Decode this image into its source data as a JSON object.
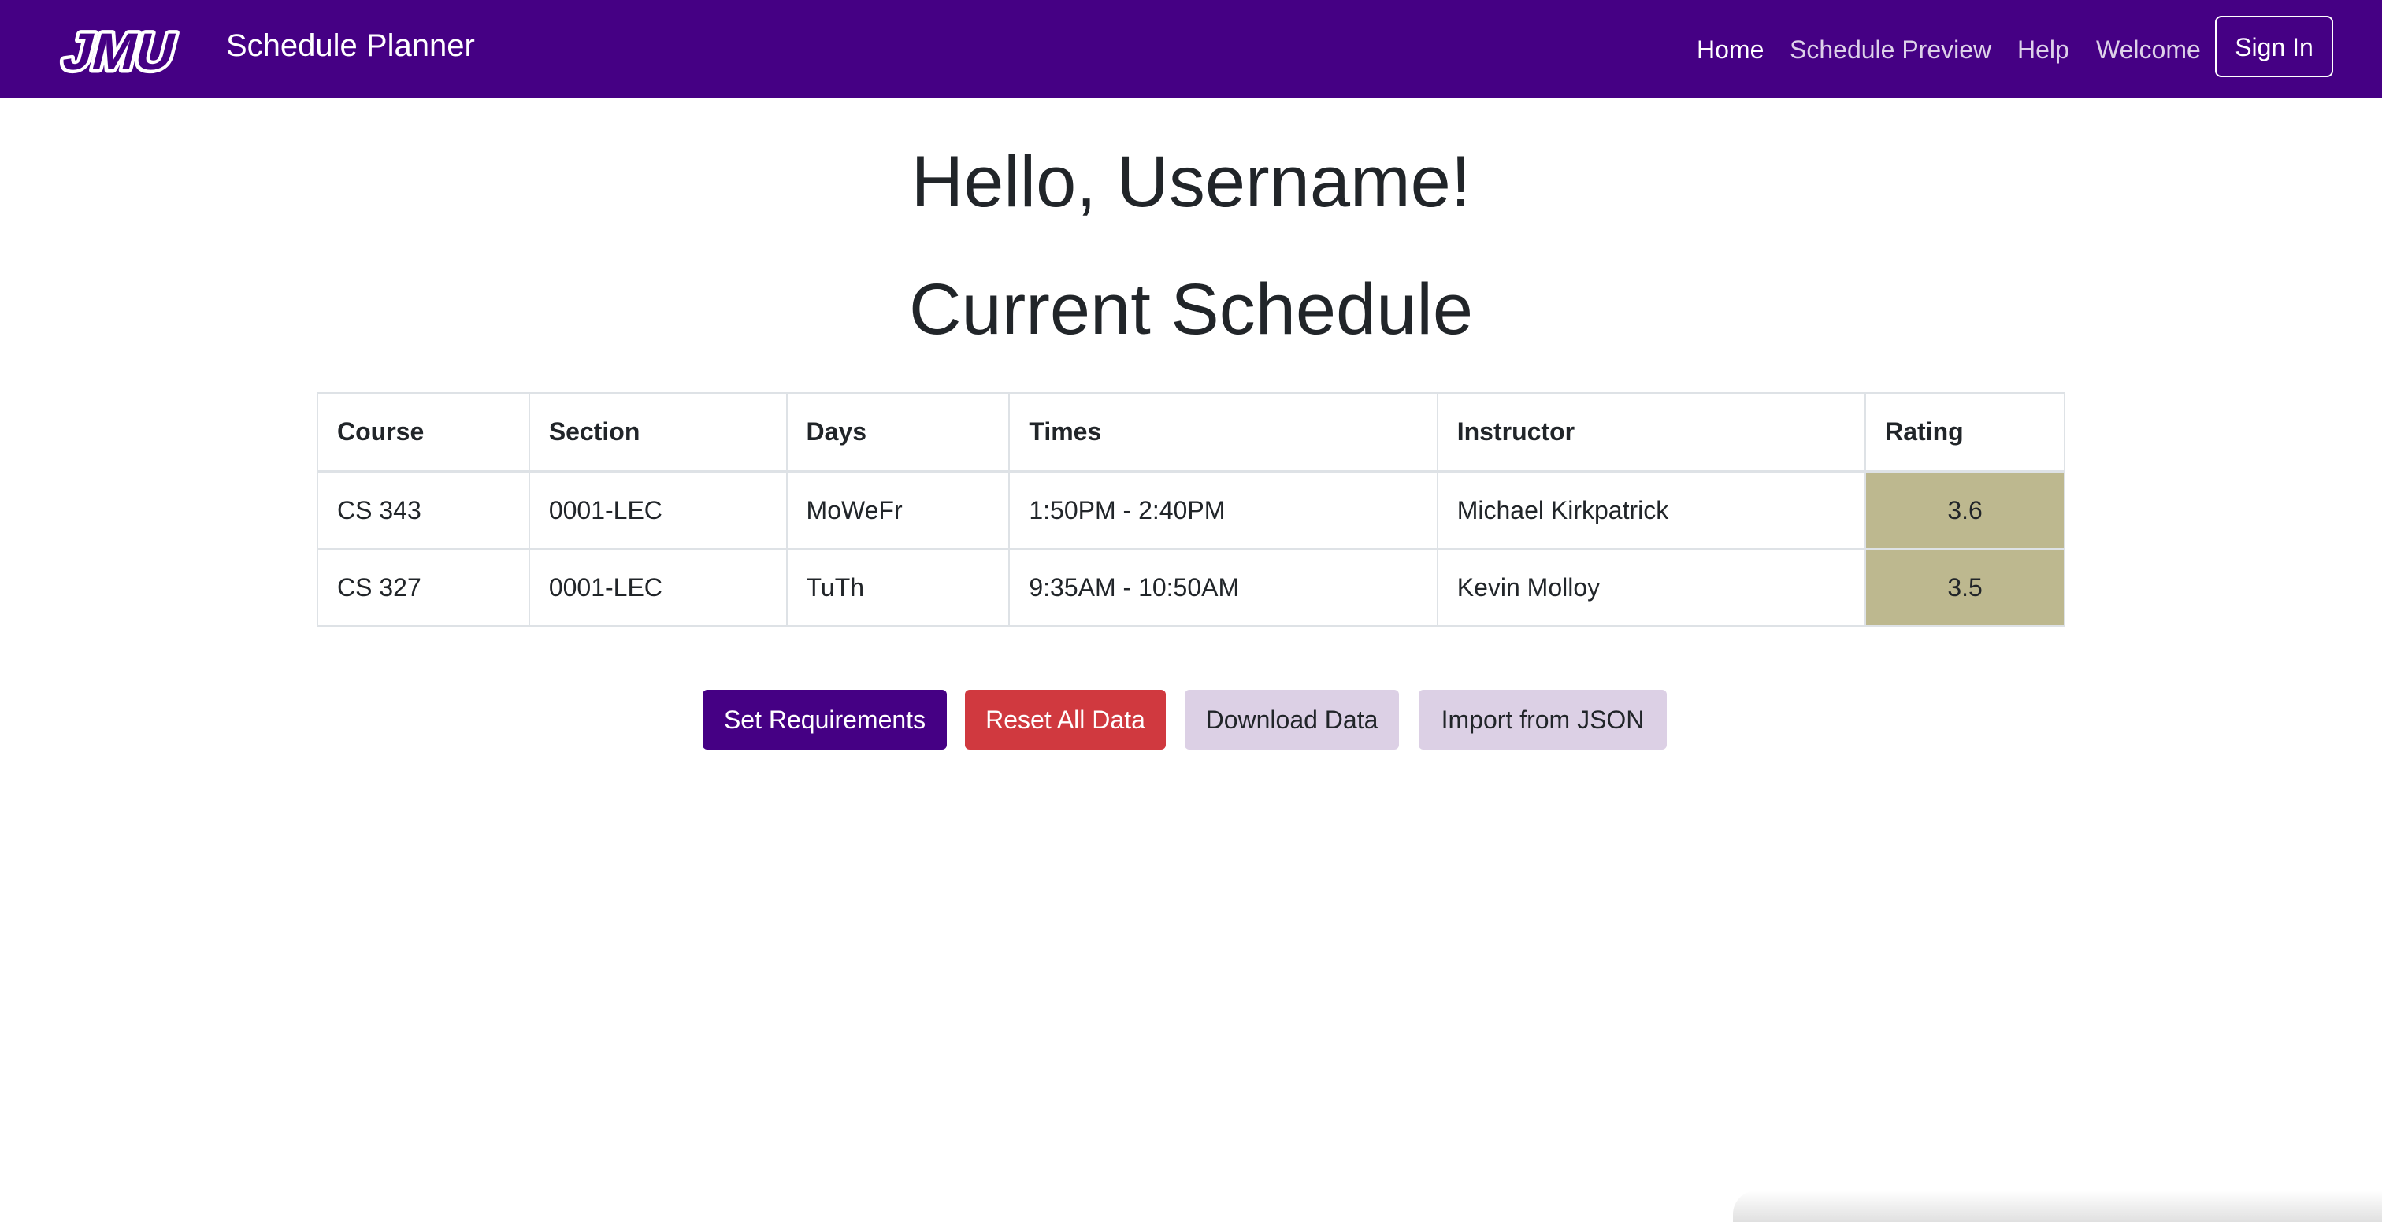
{
  "navbar": {
    "logo_text": "JMU",
    "brand_title": "Schedule Planner",
    "links": [
      {
        "label": "Home",
        "active": true
      },
      {
        "label": "Schedule Preview",
        "active": false
      },
      {
        "label": "Help",
        "active": false
      },
      {
        "label": "Welcome",
        "active": false
      }
    ],
    "signin_label": "Sign In"
  },
  "main": {
    "greeting": "Hello, Username!",
    "section_title": "Current Schedule",
    "table": {
      "headers": [
        "Course",
        "Section",
        "Days",
        "Times",
        "Instructor",
        "Rating"
      ],
      "rows": [
        {
          "course": "CS 343",
          "section": "0001-LEC",
          "days": "MoWeFr",
          "times": "1:50PM - 2:40PM",
          "instructor": "Michael Kirkpatrick",
          "rating": "3.6"
        },
        {
          "course": "CS 327",
          "section": "0001-LEC",
          "days": "TuTh",
          "times": "9:35AM - 10:50AM",
          "instructor": "Kevin Molloy",
          "rating": "3.5"
        }
      ]
    },
    "actions": {
      "set_requirements": "Set Requirements",
      "reset_all": "Reset All Data",
      "download": "Download Data",
      "import_json": "Import from JSON"
    }
  },
  "colors": {
    "brand_purple": "#450084",
    "danger_red": "#d0393f",
    "light_purple": "#dcd0e5",
    "rating_gold": "#bdb88f"
  }
}
